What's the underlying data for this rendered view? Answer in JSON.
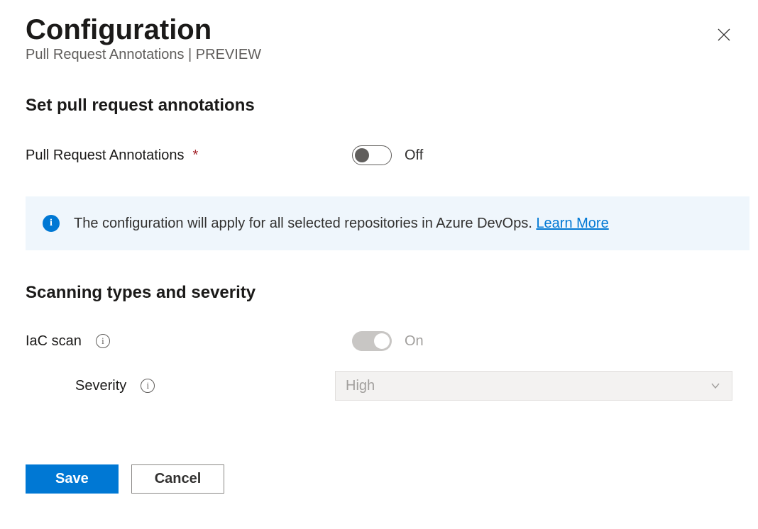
{
  "header": {
    "title": "Configuration",
    "subtitle": "Pull Request Annotations | PREVIEW"
  },
  "section_pra": {
    "heading": "Set pull request annotations",
    "label": "Pull Request Annotations",
    "required_marker": "*",
    "toggle_state": "Off"
  },
  "infobar": {
    "text": "The configuration will apply for all selected repositories in Azure DevOps.",
    "link_label": "Learn More"
  },
  "section_scan": {
    "heading": "Scanning types and severity",
    "iac_label": "IaC scan",
    "iac_toggle_state": "On",
    "severity_label": "Severity",
    "severity_value": "High"
  },
  "footer": {
    "save_label": "Save",
    "cancel_label": "Cancel"
  }
}
